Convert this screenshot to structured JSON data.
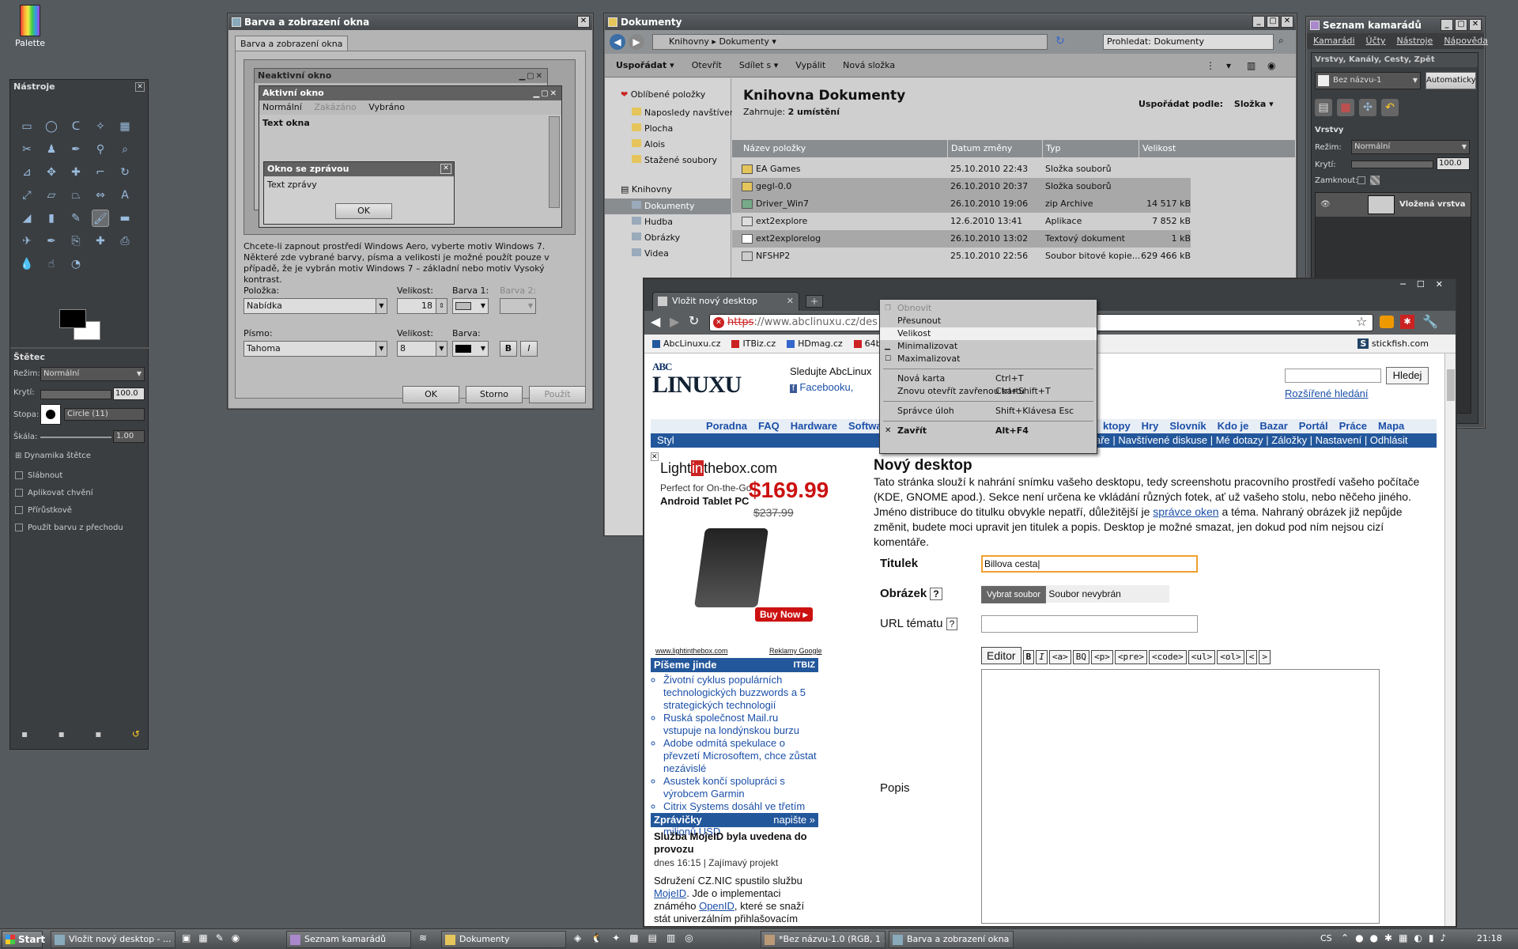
{
  "desktop": {
    "palette_label": "Palette"
  },
  "tools": {
    "title": "Nástroje",
    "brush_title": "Štětec",
    "mode_label": "Režim:",
    "mode_value": "Normální",
    "opacity_label": "Krytí:",
    "opacity_value": "100.0",
    "brush_label": "Stopa:",
    "brush_value": "Circle (11)",
    "scale_label": "Škála:",
    "scale_value": "1.00",
    "dynamics_label": "Dynamika štětce",
    "options": [
      "Slábnout",
      "Aplikovat chvění",
      "Přírůstkově",
      "Použít barvu z přechodu"
    ]
  },
  "appearance": {
    "title": "Barva a zobrazení okna",
    "tab": "Barva a zobrazení okna",
    "inactive_title": "Neaktivní okno",
    "active_title": "Aktivní okno",
    "menu_normal": "Normální",
    "menu_disabled": "Zakázáno",
    "menu_selected": "Vybráno",
    "window_text": "Text okna",
    "msg_title": "Okno se zprávou",
    "msg_text": "Text zprávy",
    "msg_ok": "OK",
    "info": "Chcete-li zapnout prostředí Windows Aero, vyberte motiv Windows 7. Některé zde vybrané barvy, písma a velikosti je možné použít pouze v případě, že je vybrán motiv Windows 7 – základní nebo motiv Vysoký kontrast.",
    "item_label": "Položka:",
    "item_value": "Nabídka",
    "size_label": "Velikost:",
    "size_value": "18",
    "color1_label": "Barva 1:",
    "color2_label": "Barva 2:",
    "font_label": "Písmo:",
    "font_value": "Tahoma",
    "font_size_label": "Velikost:",
    "font_size_value": "8",
    "font_color_label": "Barva:",
    "bold": "B",
    "italic": "I",
    "ok": "OK",
    "cancel": "Storno",
    "apply": "Použít"
  },
  "explorer": {
    "title": "Dokumenty",
    "breadcrumb": [
      "Knihovny",
      "Dokumenty"
    ],
    "search_placeholder": "Prohledat: Dokumenty",
    "toolbar": [
      "Uspořádat",
      "Otevřít",
      "Sdílet s",
      "Vypálit",
      "Nová složka"
    ],
    "favorites_header": "Oblíbené položky",
    "favorites": [
      "Naposledy navštívené",
      "Plocha",
      "Alois",
      "Stažené soubory"
    ],
    "libraries_header": "Knihovny",
    "libraries": [
      "Dokumenty",
      "Hudba",
      "Obrázky",
      "Videa"
    ],
    "lib_title": "Knihovna Dokumenty",
    "includes": "Zahrnuje:",
    "includes_value": "2 umístění",
    "arrange_label": "Uspořádat podle:",
    "arrange_value": "Složka",
    "columns": [
      "Název položky",
      "Datum změny",
      "Typ",
      "Velikost"
    ],
    "rows": [
      {
        "name": "EA Games",
        "date": "25.10.2010 22:43",
        "type": "Složka souborů",
        "size": ""
      },
      {
        "name": "gegl-0.0",
        "date": "26.10.2010 20:37",
        "type": "Složka souborů",
        "size": ""
      },
      {
        "name": "Driver_Win7",
        "date": "26.10.2010 19:06",
        "type": "zip Archive",
        "size": "14 517 kB"
      },
      {
        "name": "ext2explore",
        "date": "12.6.2010 13:41",
        "type": "Aplikace",
        "size": "7 852 kB"
      },
      {
        "name": "ext2explorelog",
        "date": "26.10.2010 13:02",
        "type": "Textový dokument",
        "size": "1 kB"
      },
      {
        "name": "NFSHP2",
        "date": "25.10.2010 22:56",
        "type": "Soubor bitové kopie...",
        "size": "629 466 kB"
      }
    ]
  },
  "friends": {
    "title": "Seznam kamarádů",
    "menu": [
      "Kamarádi",
      "Účty",
      "Nástroje",
      "Nápověda"
    ]
  },
  "layers": {
    "title": "Vrstvy, Kanály, Cesty, Zpět",
    "image": "Bez názvu-1",
    "auto": "Automaticky",
    "section": "Vrstvy",
    "mode_label": "Režim:",
    "mode_value": "Normální",
    "opacity_label": "Krytí:",
    "opacity_value": "100.0",
    "lock_label": "Zamknout:",
    "layer_name": "Vložená vrstva"
  },
  "browser": {
    "tab": "Vložit nový desktop",
    "url_scheme": "https",
    "url_rest": "://www.abclinuxu.cz/des",
    "bookmarks": [
      "AbcLinuxu.cz",
      "ITBiz.cz",
      "HDmag.cz",
      "64bi"
    ],
    "bookmark_right": "stickfish.com",
    "follow": "Sledujte AbcLinux",
    "facebook": "Facebooku,",
    "search_button": "Hledej",
    "advanced_search": "Rozšířené hledání",
    "nav": [
      "Poradna",
      "FAQ",
      "Hardware",
      "Software"
    ],
    "nav_right": [
      "ktopy",
      "Hry",
      "Slovník",
      "Kdo je",
      "Bazar",
      "Portál",
      "Práce",
      "Mapa"
    ],
    "style": "Styl",
    "user_links": "aře | Navštívené diskuse | Mé dotazy | Záložky | Nastavení | Odhlásit",
    "ad_brand1": "Light",
    "ad_brand2": "in",
    "ad_brand3": "thebox.com",
    "ad_line1": "Perfect for On-the-Go",
    "ad_line2": "Android Tablet PC",
    "ad_price": "$169.99",
    "ad_old": "$237.99",
    "ad_buy": "Buy Now ▸",
    "ad_url": "www.lightinthebox.com",
    "ad_google": "Reklamy Google",
    "writes_header": "Píšeme jinde",
    "writes_tag": "ITBIZ",
    "writes": [
      "Životní cyklus populárních technologických buzzwords a 5 strategických technologií",
      "Ruská společnost Mail.ru vstupuje na londýnskou burzu",
      "Adobe odmítá spekulace o převzetí Microsoftem, chce zůstat nezávislé",
      "Asustek končí spolupráci s výrobcem Garmin",
      "Citrix Systems dosáhl ve třetím čtvrtletí výnosů ve výši 472 milionů USD"
    ],
    "news_header": "Zprávičky",
    "news_write": "napište »",
    "news_title": "Služba MojeID byla uvedena do provozu",
    "news_meta": "dnes 16:15 | Zajímavý projekt",
    "news_text1": "Sdružení CZ.NIC spustilo službu ",
    "news_link1": "MojeID",
    "news_text2": ". Jde o implementaci známého ",
    "news_link2": "OpenID",
    "news_text3": ", které se snaží stát univerzálním přihlašovacím nástrojem k online",
    "page_title": "Nový desktop",
    "intro1": "Tato stránka slouží k nahrání snímku vašeho desktopu, tedy screenshotu pracovního prostředí vašeho počítače (KDE, GNOME apod.). Sekce není určena ke vkládání různých fotek, ať už vašeho stolu, nebo něčeho jiného. Jméno distribuce do titulku obvykle nepatří, důležitější je ",
    "intro_link": "správce oken",
    "intro2": " a téma. Nahraný obrázek již nepůjde změnit, budete moci upravit jen titulek a popis. Desktop je možné smazat, jen dokud pod ním nejsou cizí komentáře.",
    "title_label": "Titulek",
    "title_value": "Billova cesta",
    "image_label": "Obrázek",
    "help": "?",
    "choose_file": "Vybrat soubor",
    "no_file": "Soubor nevybrán",
    "url_label": "URL tématu",
    "editor": "Editor",
    "fmt": [
      "B",
      "I",
      "<a>",
      "BQ",
      "<p>",
      "<pre>",
      "<code>",
      "<ul>",
      "<ol>",
      "<",
      ">"
    ],
    "desc_label": "Popis"
  },
  "context_menu": [
    {
      "label": "Obnovit",
      "shortcut": "",
      "disabled": true
    },
    {
      "label": "Přesunout",
      "shortcut": ""
    },
    {
      "label": "Velikost",
      "shortcut": "",
      "selected": true
    },
    {
      "label": "Minimalizovat",
      "shortcut": ""
    },
    {
      "label": "Maximalizovat",
      "shortcut": ""
    },
    {
      "sep": true
    },
    {
      "label": "Nová karta",
      "shortcut": "Ctrl+T"
    },
    {
      "label": "Znovu otevřít zavřenou kartu",
      "shortcut": "Ctrl+Shift+T"
    },
    {
      "sep": true
    },
    {
      "label": "Správce úloh",
      "shortcut": "Shift+Klávesa Esc"
    },
    {
      "sep": true
    },
    {
      "label": "Zavřít",
      "shortcut": "Alt+F4",
      "bold": true
    }
  ],
  "taskbar": {
    "start": "Start",
    "tasks": [
      "Vložit nový desktop - ...",
      "Seznam kamarádů",
      "Dokumenty",
      "*Bez názvu-1.0 (RGB, 1 ...",
      "Barva a zobrazení okna"
    ],
    "lang": "CS",
    "clock": "21:18"
  }
}
